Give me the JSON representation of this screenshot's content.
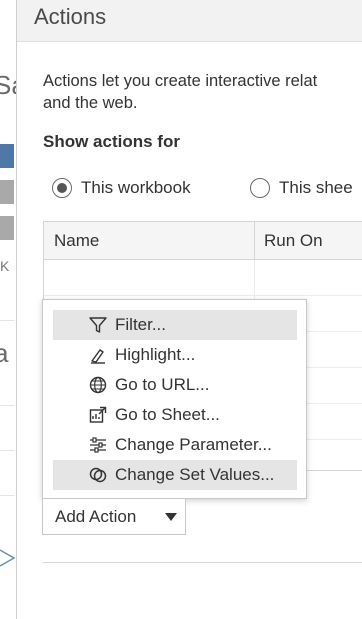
{
  "background": {
    "fragment_top": "Sa",
    "fragment_mid": "a",
    "k_label": "K",
    "bar_colors": [
      "#4e79a7",
      "#a9a9a9",
      "#a9a9a9"
    ]
  },
  "dialog": {
    "title": "Actions",
    "description_line1": "Actions let you create interactive relat",
    "description_line2": "and the web.",
    "show_actions_label": "Show actions for",
    "radio_workbook": "This workbook",
    "radio_sheet": "This shee",
    "selected_scope": "This workbook",
    "table": {
      "columns": [
        "Name",
        "Run On"
      ],
      "rows": [
        [
          "",
          ""
        ],
        [
          "",
          ""
        ],
        [
          "",
          ""
        ],
        [
          "",
          ""
        ],
        [
          "",
          ""
        ],
        [
          "",
          ""
        ]
      ]
    },
    "add_action_label": "Add Action"
  },
  "menu": {
    "items": [
      {
        "label": "Filter...",
        "icon": "filter-icon",
        "highlighted": true
      },
      {
        "label": "Highlight...",
        "icon": "highlight-icon",
        "highlighted": false
      },
      {
        "label": "Go to URL...",
        "icon": "globe-icon",
        "highlighted": false
      },
      {
        "label": "Go to Sheet...",
        "icon": "go-to-sheet-icon",
        "highlighted": false
      },
      {
        "label": "Change Parameter...",
        "icon": "sliders-icon",
        "highlighted": false
      },
      {
        "label": "Change Set Values...",
        "icon": "set-values-icon",
        "highlighted": true
      }
    ]
  },
  "colors": {
    "accent": "#4e79a7",
    "highlight": "#e5e5e5",
    "titlebar": "#f2f2f2"
  }
}
